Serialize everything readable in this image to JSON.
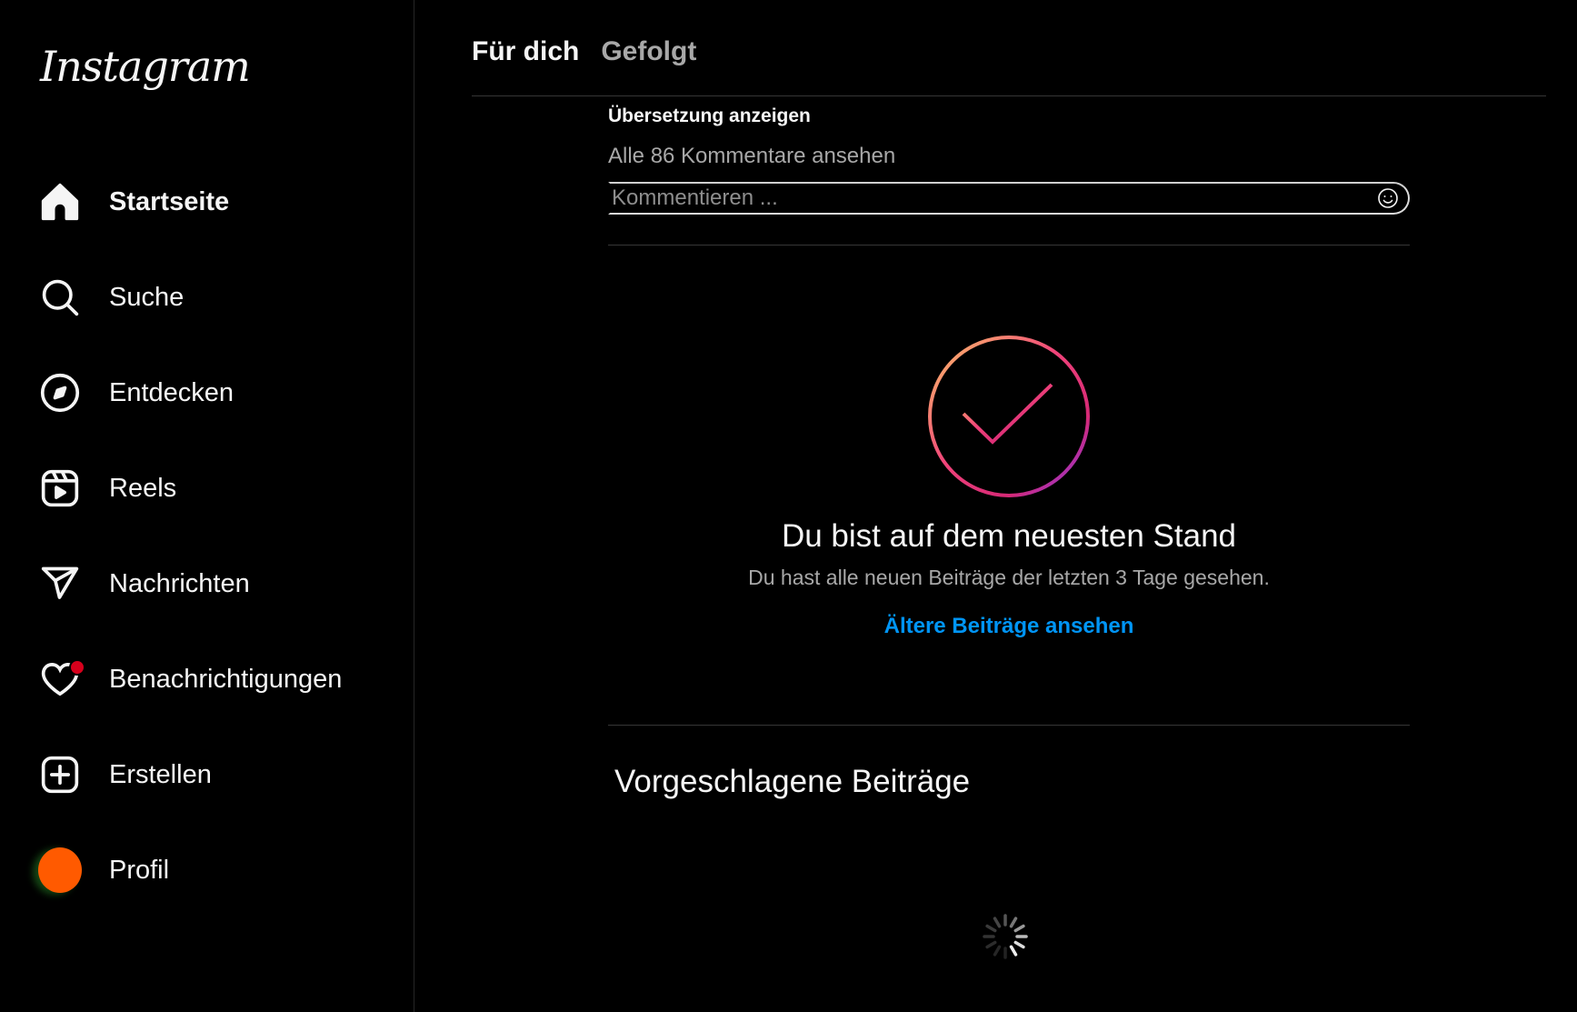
{
  "app": {
    "logo_text": "Instagram"
  },
  "sidebar": {
    "items": [
      {
        "label": "Startseite",
        "icon": "home-icon",
        "active": true
      },
      {
        "label": "Suche",
        "icon": "search-icon"
      },
      {
        "label": "Entdecken",
        "icon": "compass-icon"
      },
      {
        "label": "Reels",
        "icon": "reels-icon"
      },
      {
        "label": "Nachrichten",
        "icon": "send-icon"
      },
      {
        "label": "Benachrichtigungen",
        "icon": "heart-icon",
        "has_badge": true
      },
      {
        "label": "Erstellen",
        "icon": "plus-square-icon"
      },
      {
        "label": "Profil",
        "icon": "avatar"
      }
    ]
  },
  "feed": {
    "tabs": [
      {
        "label": "Für dich",
        "active": true
      },
      {
        "label": "Gefolgt",
        "active": false
      }
    ],
    "post": {
      "translate_label": "Übersetzung anzeigen",
      "comments_label": "Alle 86 Kommentare ansehen",
      "comment_placeholder": "Kommentieren ..."
    },
    "caught_up": {
      "title": "Du bist auf dem neuesten Stand",
      "subtitle": "Du hast alle neuen Beiträge der letzten 3 Tage gesehen.",
      "older_link": "Ältere Beiträge ansehen"
    },
    "suggested_title": "Vorgeschlagene Beiträge"
  },
  "colors": {
    "background": "#000000",
    "link_blue": "#0095f6",
    "notification_badge": "#d6001c",
    "avatar": "#ff5a00"
  }
}
